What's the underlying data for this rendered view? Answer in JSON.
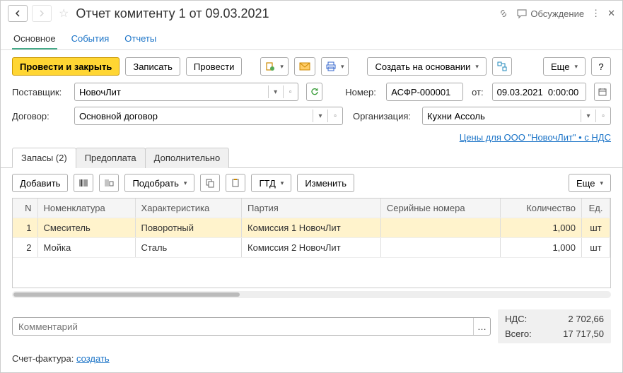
{
  "title": "Отчет комитенту 1 от 09.03.2021",
  "discussion_label": "Обсуждение",
  "nav_tabs": {
    "main": "Основное",
    "events": "События",
    "reports": "Отчеты"
  },
  "toolbar": {
    "post_close": "Провести и закрыть",
    "save": "Записать",
    "post": "Провести",
    "create_based": "Создать на основании",
    "more": "Еще",
    "help": "?"
  },
  "fields": {
    "supplier_label": "Поставщик:",
    "supplier_value": "НовочЛит",
    "number_label": "Номер:",
    "number_value": "АСФР-000001",
    "date_label": "от:",
    "date_value": "09.03.2021  0:00:00",
    "contract_label": "Договор:",
    "contract_value": "Основной договор",
    "org_label": "Организация:",
    "org_value": "Кухни Ассоль"
  },
  "price_link": "Цены для ООО \"НовочЛит\" • с НДС",
  "inner_tabs": {
    "stock": "Запасы (2)",
    "prepay": "Предоплата",
    "extra": "Дополнительно"
  },
  "table_toolbar": {
    "add": "Добавить",
    "select": "Подобрать",
    "gtd": "ГТД",
    "change": "Изменить",
    "more": "Еще"
  },
  "table": {
    "headers": {
      "n": "N",
      "nom": "Номенклатура",
      "char": "Характеристика",
      "batch": "Партия",
      "serial": "Серийные номера",
      "qty": "Количество",
      "unit": "Ед."
    },
    "rows": [
      {
        "n": "1",
        "nom": "Смеситель",
        "char": "Поворотный",
        "batch": "Комиссия 1 НовочЛит",
        "serial": "",
        "qty": "1,000",
        "unit": "шт",
        "selected": true
      },
      {
        "n": "2",
        "nom": "Мойка",
        "char": "Сталь",
        "batch": "Комиссия 2 НовочЛит",
        "serial": "",
        "qty": "1,000",
        "unit": "шт",
        "selected": false
      }
    ]
  },
  "comment_placeholder": "Комментарий",
  "totals": {
    "vat_label": "НДС:",
    "vat_value": "2 702,66",
    "total_label": "Всего:",
    "total_value": "17 717,50"
  },
  "invoice": {
    "label": "Счет-фактура:",
    "link": "создать"
  }
}
